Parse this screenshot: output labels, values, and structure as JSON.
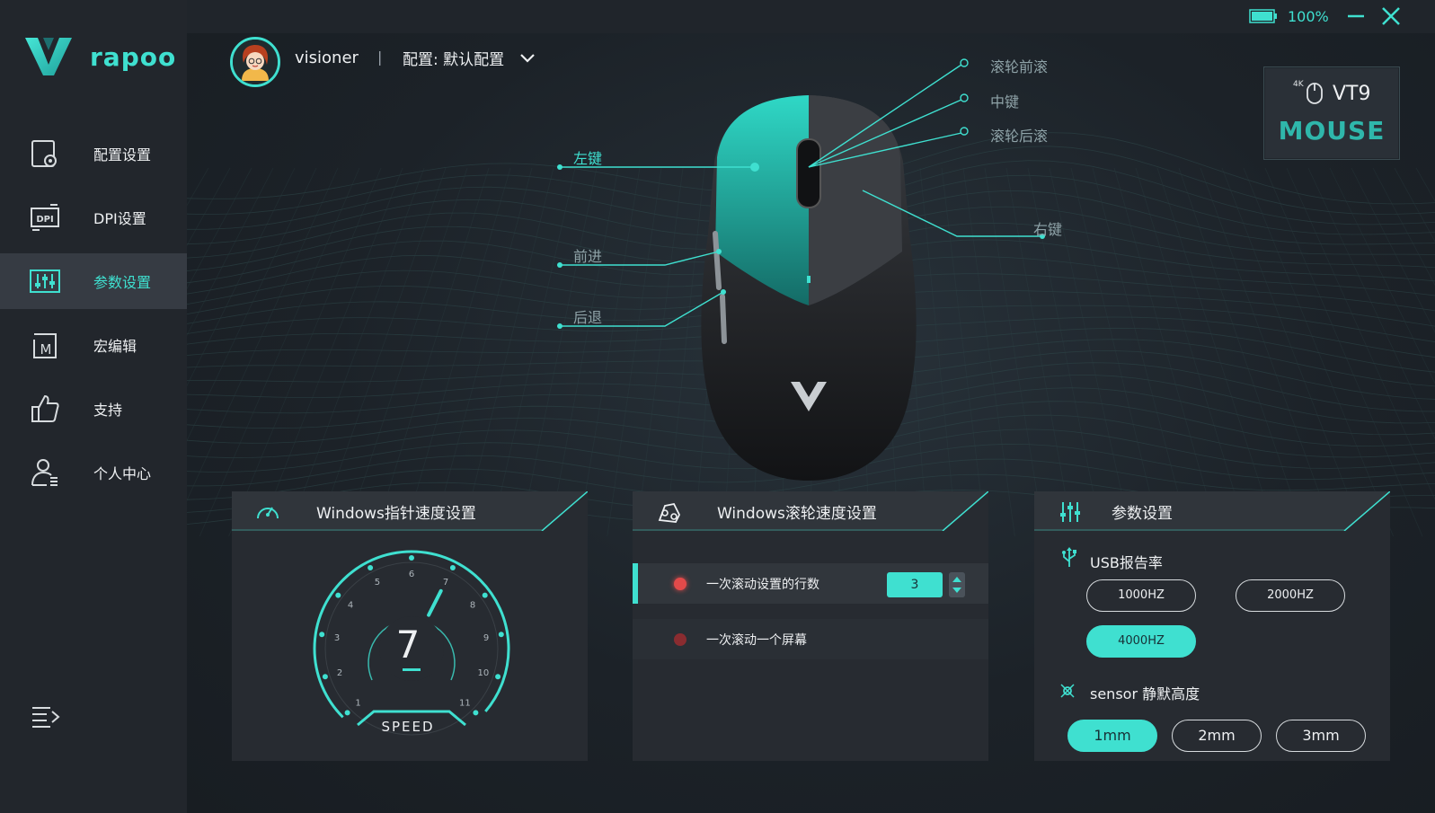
{
  "brand": {
    "name": "rapoo",
    "accent": "#3fe0d0"
  },
  "sidebar": {
    "items": [
      {
        "label": "配置设置",
        "icon": "config-icon",
        "active": false
      },
      {
        "label": "DPI设置",
        "icon": "dpi-icon",
        "active": false
      },
      {
        "label": "参数设置",
        "icon": "sliders-icon",
        "active": true
      },
      {
        "label": "宏编辑",
        "icon": "macro-icon",
        "active": false
      },
      {
        "label": "支持",
        "icon": "thumbs-up-icon",
        "active": false
      },
      {
        "label": "个人中心",
        "icon": "user-center-icon",
        "active": false
      }
    ],
    "collapse_icon": "menu-collapse-icon"
  },
  "window": {
    "battery_pct": "100%",
    "battery_level": 1.0
  },
  "user": {
    "name": "visioner",
    "separator": "|",
    "profile_label": "配置: 默认配置"
  },
  "device": {
    "resolution_tag": "4K",
    "model": "VT9",
    "type_label": "MOUSE"
  },
  "callouts": {
    "left_button": "左键",
    "forward": "前进",
    "back": "后退",
    "scroll_up": "滚轮前滚",
    "middle": "中键",
    "scroll_down": "滚轮后滚",
    "right_button": "右键"
  },
  "pointer_panel": {
    "title": "Windows指针速度设置",
    "speed_value": "7",
    "speed_label": "SPEED",
    "ticks": [
      "1",
      "2",
      "3",
      "4",
      "5",
      "6",
      "7",
      "8",
      "9",
      "10",
      "11"
    ],
    "current": 7,
    "max": 11
  },
  "scroll_panel": {
    "title": "Windows滚轮速度设置",
    "options": [
      {
        "label": "一次滚动设置的行数",
        "selected": true
      },
      {
        "label": "一次滚动一个屏幕",
        "selected": false
      }
    ],
    "lines_value": "3"
  },
  "params_panel": {
    "title": "参数设置",
    "usb_label": "USB报告率",
    "rates": [
      {
        "label": "1000HZ",
        "selected": false
      },
      {
        "label": "2000HZ",
        "selected": false
      },
      {
        "label": "4000HZ",
        "selected": true
      }
    ],
    "lod_label": "sensor 静默高度",
    "lod": [
      {
        "label": "1mm",
        "selected": true
      },
      {
        "label": "2mm",
        "selected": false
      },
      {
        "label": "3mm",
        "selected": false
      }
    ]
  }
}
